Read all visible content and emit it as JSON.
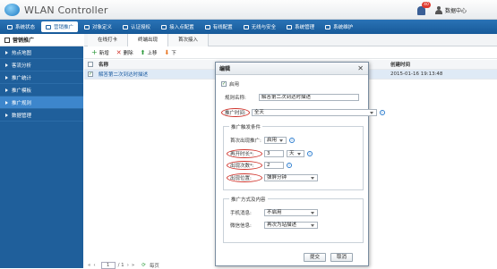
{
  "header": {
    "title": "WLAN Controller",
    "badge": "40",
    "datacenter": "数据中心"
  },
  "nav": [
    {
      "label": "系统状态",
      "active": false
    },
    {
      "label": "营销推广",
      "active": true
    },
    {
      "label": "对象定义",
      "active": false
    },
    {
      "label": "认证授权",
      "active": false
    },
    {
      "label": "接入点配置",
      "active": false
    },
    {
      "label": "有线配置",
      "active": false
    },
    {
      "label": "无线与安全",
      "active": false
    },
    {
      "label": "系统管理",
      "active": false
    },
    {
      "label": "系统维护",
      "active": false
    }
  ],
  "sidebar": {
    "title": "营销推广",
    "items": [
      {
        "label": "热点地图",
        "active": false
      },
      {
        "label": "客流分析",
        "active": false
      },
      {
        "label": "推广统计",
        "active": false
      },
      {
        "label": "推广模板",
        "active": false
      },
      {
        "label": "推广规则",
        "active": true
      },
      {
        "label": "数据管理",
        "active": false
      }
    ]
  },
  "tabs": [
    "在线打卡",
    "终端出现",
    "首次接入"
  ],
  "toolbar": {
    "add": "新增",
    "delete": "删除",
    "up": "上移",
    "down": "下"
  },
  "grid": {
    "col_name": "名称",
    "col_time": "创建时间",
    "rows": [
      {
        "name": "解答第二次到达时描述",
        "time": "2015-01-16 19:13:48",
        "checked": true
      }
    ]
  },
  "pager": {
    "prefix": "1",
    "page": "1",
    "of": "/ 1",
    "suffix": "每页"
  },
  "dialog": {
    "title": "编辑",
    "enable_label": "启用",
    "rule_name_label": "规则名称:",
    "rule_name_value": "解答第二次到达时描述",
    "push_time_label": "推广时间:",
    "push_time_value": "全天",
    "trigger_legend": "推广触发条件",
    "first_push_label": "首次出现推广:",
    "first_push_value": "启用",
    "interval_label": "再开时长*:",
    "interval_value": "3",
    "interval_unit": "天",
    "count_label": "出现次数*:",
    "count_value": "2",
    "position_label": "出现位置:",
    "position_value": "弹屏分钟",
    "method_legend": "推广方式及内容",
    "sms_label": "手机消息:",
    "sms_value": "不启用",
    "wechat_label": "微信信息:",
    "wechat_value": "再次为站描述",
    "submit": "提交",
    "cancel": "取消"
  }
}
